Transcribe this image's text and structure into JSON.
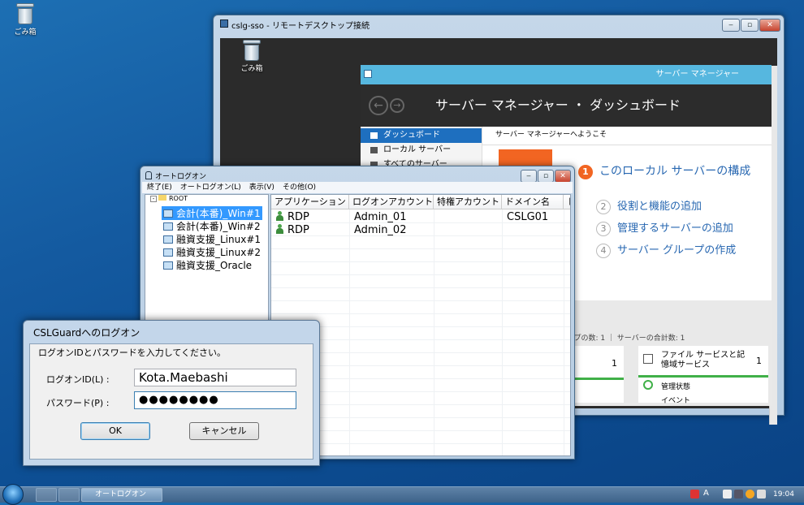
{
  "desktop": {
    "recycle_bin_label": "ごみ箱"
  },
  "rdp_window": {
    "title": "cslg-sso - リモートデスクトップ接続",
    "recycle_bin_label": "ごみ箱"
  },
  "server_manager": {
    "window_title": "サーバー マネージャー",
    "header": "サーバー マネージャー ・ ダッシュボード",
    "nav": [
      "ダッシュボード",
      "ローカル サーバー",
      "すべてのサーバー"
    ],
    "welcome": "サーバー マネージャーへようこそ",
    "steps": [
      {
        "n": "1",
        "label": "このローカル サーバーの構成"
      },
      {
        "n": "2",
        "label": "役割と機能の追加"
      },
      {
        "n": "3",
        "label": "管理するサーバーの追加"
      },
      {
        "n": "4",
        "label": "サーバー グループの作成"
      }
    ],
    "group_counts": "グループの数: 1 ｜ サーバーの合計数: 1",
    "tile_left_count": "1",
    "tile_right": {
      "title": "ファイル サービスと記憶域サービス",
      "count": "1",
      "status": "管理状態",
      "events": "イベント"
    },
    "accent_color": "#f26522",
    "titlebar_color": "#56b7df"
  },
  "autologon": {
    "title": "オートログオン",
    "menu": [
      "終了(E)",
      "オートログオン(L)",
      "表示(V)",
      "その他(O)"
    ],
    "tree_root": "ROOT",
    "tree_items": [
      "会計(本番)_Win#1",
      "会計(本番)_Win#2",
      "融資支援_Linux#1",
      "融資支援_Linux#2",
      "融資支援_Oracle"
    ],
    "columns": [
      "アプリケーション",
      "ログオンアカウント",
      "特権アカウント",
      "ドメイン名",
      "ド"
    ],
    "rows": [
      {
        "app": "RDP",
        "account": "Admin_01",
        "priv": "",
        "domain": "CSLG01"
      },
      {
        "app": "RDP",
        "account": "Admin_02",
        "priv": "",
        "domain": ""
      }
    ]
  },
  "login_dialog": {
    "title": "CSLGuardへのログオン",
    "instruction": "ログオンIDとパスワードを入力してください。",
    "id_label": "ログオンID(L) :",
    "id_value": "Kota.Maebashi",
    "pw_label": "パスワード(P) :",
    "pw_value": "●●●●●●●●",
    "ok": "OK",
    "cancel": "キャンセル"
  },
  "taskbar": {
    "task_label": "オートログオン",
    "time": "19:04",
    "ime": "A"
  }
}
